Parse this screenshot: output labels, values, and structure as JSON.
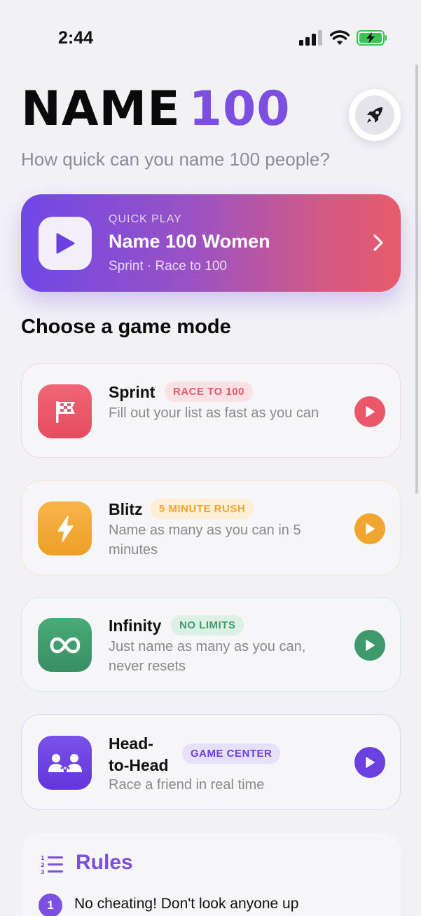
{
  "status": {
    "time": "2:44"
  },
  "header": {
    "title_word": "NAME",
    "title_number": "100",
    "subtitle": "How quick can you name 100 people?"
  },
  "quick_play": {
    "eyebrow": "QUICK PLAY",
    "title": "Name 100 Women",
    "subtitle": "Sprint · Race to 100"
  },
  "section_title": "Choose a game mode",
  "modes": [
    {
      "title": "Sprint",
      "badge": "RACE TO 100",
      "desc": "Fill out your list as fast as you can",
      "color": "#e9576a",
      "badge_bg": "#fbe1e4",
      "icon": "checkered-flag-icon"
    },
    {
      "title": "Blitz",
      "badge": "5 MINUTE RUSH",
      "desc": "Name as many as you can in 5 minutes",
      "color": "#f0a531",
      "badge_bg": "#fcefd6",
      "icon": "lightning-bolt-icon"
    },
    {
      "title": "Infinity",
      "badge": "NO LIMITS",
      "desc": "Just name as many as you can, never resets",
      "color": "#3e9a6c",
      "badge_bg": "#ddf0e5",
      "icon": "infinity-icon"
    },
    {
      "title": "Head-\nto-Head",
      "title_line1": "Head-",
      "title_line2": "to-Head",
      "badge": "GAME CENTER",
      "desc": "Race a friend in real time",
      "color": "#6a40de",
      "badge_bg": "#e6e0fa",
      "icon": "two-people-icon"
    }
  ],
  "rules": {
    "title": "Rules",
    "items": [
      {
        "num": "1",
        "text": "No cheating! Don't look anyone up"
      }
    ]
  },
  "colors": {
    "accent": "#7b4fe0",
    "background": "#f2f1f6"
  }
}
